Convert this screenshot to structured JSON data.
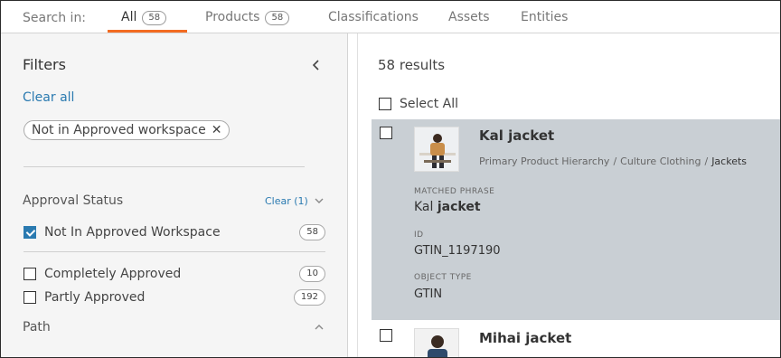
{
  "tabs": {
    "search_in_label": "Search in:",
    "items": [
      {
        "label": "All",
        "count": "58"
      },
      {
        "label": "Products",
        "count": "58"
      },
      {
        "label": "Classifications"
      },
      {
        "label": "Assets"
      },
      {
        "label": "Entities"
      }
    ]
  },
  "sidebar": {
    "title": "Filters",
    "clear_all": "Clear all",
    "active_chip": "Not in Approved workspace",
    "chip_remove": "✕",
    "approval_status": {
      "title": "Approval Status",
      "clear_label": "Clear (1)",
      "options": [
        {
          "label": "Not In Approved Workspace",
          "count": "58",
          "checked": true
        },
        {
          "label": "Completely Approved",
          "count": "10",
          "checked": false
        },
        {
          "label": "Partly Approved",
          "count": "192",
          "checked": false
        }
      ]
    },
    "path": {
      "title": "Path"
    }
  },
  "results": {
    "count_text": "58 results",
    "select_all": "Select All",
    "items": [
      {
        "name": "Kal jacket",
        "breadcrumb": [
          "Primary Product Hierarchy",
          "/",
          "Culture Clothing",
          "/",
          "Jackets"
        ],
        "matched_phrase_label": "MATCHED PHRASE",
        "matched_phrase_plain": "Kal ",
        "matched_phrase_bold": "jacket",
        "id_label": "ID",
        "id_value": "GTIN_1197190",
        "object_type_label": "OBJECT TYPE",
        "object_type_value": "GTIN"
      },
      {
        "name": "Mihai jacket"
      }
    ]
  },
  "colors": {
    "accent": "#f36b21",
    "link": "#2a7ab0",
    "selected_card": "#c9cfd4",
    "sidebar_bg": "#f5f5f5"
  }
}
